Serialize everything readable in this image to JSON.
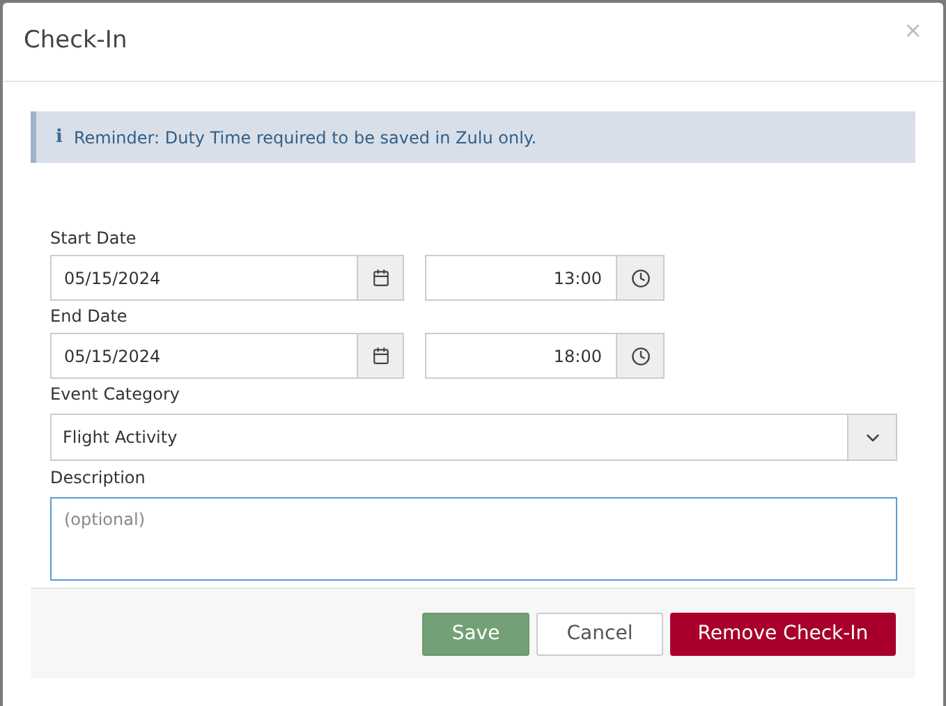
{
  "dialog": {
    "title": "Check-In",
    "close": "×"
  },
  "alert": {
    "icon": "i",
    "text": "Reminder: Duty Time required to be saved in Zulu only."
  },
  "fields": [
    {
      "label": "Start Date",
      "date": "05/15/2024",
      "time": "13:00"
    },
    {
      "label": "End Date",
      "date": "05/15/2024",
      "time": "18:00"
    }
  ],
  "category": {
    "label": "Event Category",
    "value": "Flight Activity"
  },
  "description": {
    "label": "Description",
    "placeholder": "(optional)"
  },
  "buttons": [
    {
      "label": "Save",
      "kind": "primary"
    },
    {
      "label": "Cancel",
      "kind": "default"
    },
    {
      "label": "Remove Check-In",
      "kind": "danger"
    }
  ]
}
